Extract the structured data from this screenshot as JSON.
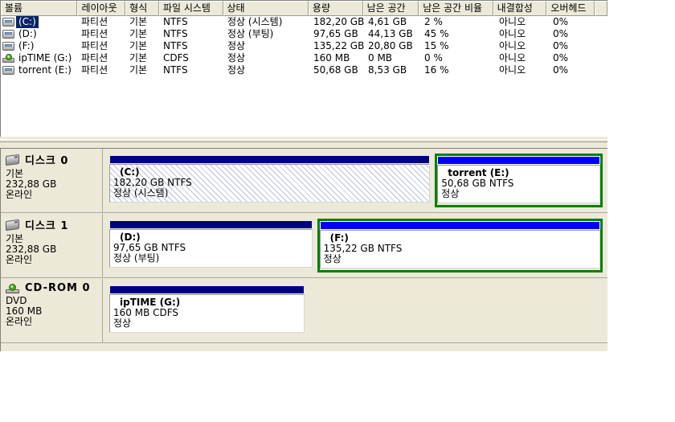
{
  "volume_list": {
    "columns": [
      {
        "label": "볼륨",
        "width": 96
      },
      {
        "label": "레이아웃",
        "width": 60
      },
      {
        "label": "형식",
        "width": 42
      },
      {
        "label": "파일 시스템",
        "width": 80
      },
      {
        "label": "상태",
        "width": 107
      },
      {
        "label": "용량",
        "width": 68
      },
      {
        "label": "남은 공간",
        "width": 70
      },
      {
        "label": "남은 공간 비율",
        "width": 93
      },
      {
        "label": "내결합성",
        "width": 67
      },
      {
        "label": "오버헤드",
        "width": 60
      },
      {
        "label": "",
        "width": 16
      }
    ],
    "rows": [
      {
        "icon": "hdd-icon",
        "volume": "(C:)",
        "selected": true,
        "layout": "파티션",
        "type": "기본",
        "fs": "NTFS",
        "status": "정상 (시스템)",
        "capacity": "182,20 GB",
        "free": "4,61 GB",
        "free_pct": "2 %",
        "fault_tolerance": "아니오",
        "overhead": "0%"
      },
      {
        "icon": "hdd-icon",
        "volume": "(D:)",
        "selected": false,
        "layout": "파티션",
        "type": "기본",
        "fs": "NTFS",
        "status": "정상 (부팅)",
        "capacity": "97,65 GB",
        "free": "44,13 GB",
        "free_pct": "45 %",
        "fault_tolerance": "아니오",
        "overhead": "0%"
      },
      {
        "icon": "hdd-icon",
        "volume": "(F:)",
        "selected": false,
        "layout": "파티션",
        "type": "기본",
        "fs": "NTFS",
        "status": "정상",
        "capacity": "135,22 GB",
        "free": "20,80 GB",
        "free_pct": "15 %",
        "fault_tolerance": "아니오",
        "overhead": "0%"
      },
      {
        "icon": "cdrom-icon",
        "volume": "ipTIME (G:)",
        "selected": false,
        "layout": "파티션",
        "type": "기본",
        "fs": "CDFS",
        "status": "정상",
        "capacity": "160 MB",
        "free": "0 MB",
        "free_pct": "0 %",
        "fault_tolerance": "아니오",
        "overhead": "0%"
      },
      {
        "icon": "hdd-icon",
        "volume": "torrent (E:)",
        "selected": false,
        "layout": "파티션",
        "type": "기본",
        "fs": "NTFS",
        "status": "정상",
        "capacity": "50,68 GB",
        "free": "8,53 GB",
        "free_pct": "16 %",
        "fault_tolerance": "아니오",
        "overhead": "0%"
      }
    ]
  },
  "graphical_view": {
    "disks": [
      {
        "icon": "disk-icon",
        "name": "디스크 0",
        "type": "기본",
        "size": "232,88 GB",
        "state": "온라인",
        "partitions": [
          {
            "label": "(C:)",
            "size_fs": "182,20 GB NTFS",
            "status": "정상 (시스템)",
            "selected": false,
            "hatched": true,
            "flex": 583
          },
          {
            "label": "torrent  (E:)",
            "size_fs": "50,68 GB NTFS",
            "status": "정상",
            "selected": true,
            "hatched": false,
            "flex": 296
          }
        ]
      },
      {
        "icon": "disk-icon",
        "name": "디스크 1",
        "type": "기본",
        "size": "232,88 GB",
        "state": "온라인",
        "partitions": [
          {
            "label": "(D:)",
            "size_fs": "97,65 GB NTFS",
            "status": "정상 (부팅)",
            "selected": false,
            "hatched": false,
            "flex": 420
          },
          {
            "label": "(F:)",
            "size_fs": "135,22 GB NTFS",
            "status": "정상",
            "selected": true,
            "hatched": false,
            "flex": 581
          }
        ]
      },
      {
        "icon": "cdrom-drive-icon",
        "name": "CD-ROM 0",
        "type": "DVD",
        "size": "160 MB",
        "state": "온라인",
        "partitions": [
          {
            "label": "ipTIME  (G:)",
            "size_fs": "160 MB CDFS",
            "status": "정상",
            "selected": false,
            "hatched": false,
            "flex": 400
          },
          {
            "label": "",
            "size_fs": "",
            "status": "",
            "selected": false,
            "hatched": false,
            "flex": 601,
            "empty": true
          }
        ]
      }
    ]
  },
  "colors": {
    "window_face": "#ece9d8",
    "partition_bar": "#000080",
    "partition_bar_selected": "#0000ff",
    "selection_border": "#008000",
    "row_selection": "#0a246a"
  }
}
